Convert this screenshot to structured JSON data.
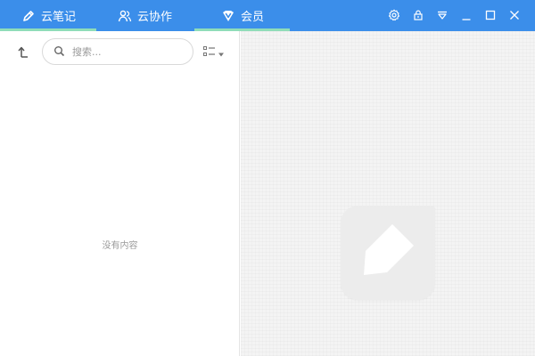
{
  "titlebar": {
    "tabs": [
      {
        "label": "云笔记",
        "icon": "pencil-icon"
      },
      {
        "label": "云协作",
        "icon": "users-icon"
      },
      {
        "label": "会员",
        "icon": "vip-diamond-icon"
      }
    ],
    "controls": [
      "settings-icon",
      "lock-icon",
      "dropdown-icon",
      "minimize-icon",
      "maximize-icon",
      "close-icon"
    ]
  },
  "leftpanel": {
    "search_placeholder": "搜索...",
    "empty_text": "没有内容"
  },
  "colors": {
    "titlebar_bg": "#3b8eea",
    "tab_underline": "#8fdcb8",
    "placeholder_text": "#9a9a9a"
  }
}
